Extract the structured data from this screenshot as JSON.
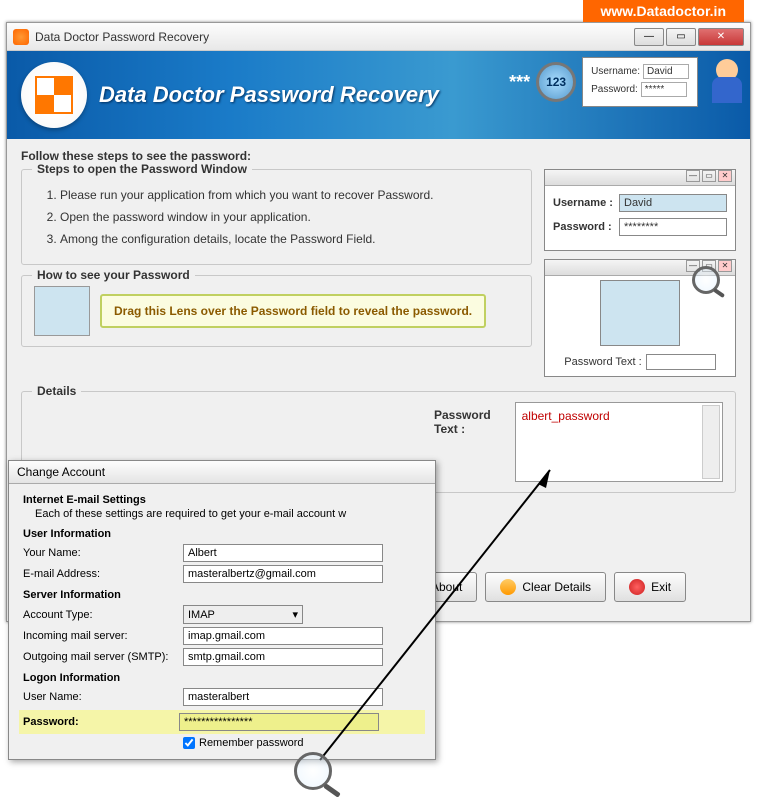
{
  "url_banner": "www.Datadoctor.in",
  "window": {
    "title": "Data Doctor Password Recovery"
  },
  "banner": {
    "title": "Data Doctor Password Recovery",
    "stars": "***",
    "lens_text": "123",
    "card": {
      "username_label": "Username:",
      "username_value": "David",
      "password_label": "Password:",
      "password_value": "*****"
    }
  },
  "intro": "Follow these steps to see the password:",
  "steps_legend": "Steps to open the Password Window",
  "steps": [
    "Please run your application from which you want to recover Password.",
    "Open the password window in your application.",
    "Among the configuration details, locate the Password Field."
  ],
  "howto_legend": "How to see your Password",
  "drag_msg": "Drag this Lens over the Password field to reveal the password.",
  "mini1": {
    "username_label": "Username :",
    "username_value": "David",
    "password_label": "Password :",
    "password_value": "********"
  },
  "mini2": {
    "pw_label": "Password Text :"
  },
  "details_legend": "Details",
  "pw_text_label": "Password Text :",
  "pw_text_value": "albert_password",
  "buttons": {
    "about": "About",
    "clear": "Clear Details",
    "exit": "Exit"
  },
  "email": {
    "title": "Change Account",
    "intro": "Internet E-mail Settings",
    "sub": "Each of these settings are required to get your e-mail account w",
    "user_info_h": "User Information",
    "your_name_l": "Your Name:",
    "your_name_v": "Albert",
    "email_l": "E-mail Address:",
    "email_v": "masteralbertz@gmail.com",
    "server_info_h": "Server Information",
    "acct_type_l": "Account Type:",
    "acct_type_v": "IMAP",
    "incoming_l": "Incoming mail server:",
    "incoming_v": "imap.gmail.com",
    "outgoing_l": "Outgoing mail server (SMTP):",
    "outgoing_v": "smtp.gmail.com",
    "logon_h": "Logon Information",
    "username_l": "User Name:",
    "username_v": "masteralbert",
    "password_l": "Password:",
    "password_v": "****************",
    "remember": "Remember password"
  }
}
